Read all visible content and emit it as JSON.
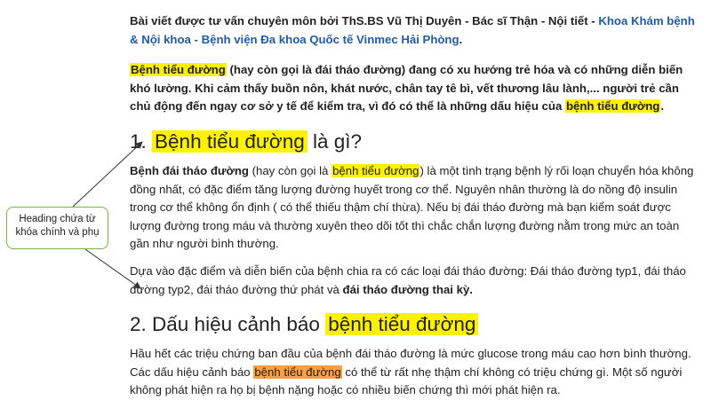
{
  "intro": {
    "prefix": "Bài viết được tư vấn chuyên môn bởi ThS.BS Vũ Thị Duyên - Bác sĩ Thận - Nội tiết - ",
    "link": "Khoa Khám bệnh & Nội khoa - Bệnh viện Đa khoa Quốc tế Vinmec Hải Phòng",
    "suffix": "."
  },
  "lead": {
    "kw1": "Bệnh tiểu đường",
    "text1": " (hay còn gọi là đái tháo đường) đang có xu hướng trẻ hóa và có những diễn biến khó lường. Khi cảm thấy buồn nôn, khát nước, chân tay tê bì, vết thương lâu lành,... người trẻ cần chủ động đến ngay cơ sở y tế để kiểm tra, vì đó có thể là những dấu hiệu của ",
    "kw2": "bệnh tiểu đường",
    "text2": "."
  },
  "section1": {
    "number": "1. ",
    "keyword": "Bệnh tiểu đường",
    "rest": " là gì?",
    "p1": {
      "bold": "Bệnh đái tháo đường",
      "t1": " (hay còn gọi là ",
      "kw": "bệnh tiểu đường",
      "t2": ") là một tình trạng bệnh lý rối loạn chuyển hóa không đồng nhất, có đặc điểm tăng lượng đường huyết trong cơ thể. Nguyên nhân thường là do nồng độ insulin trong cơ thể không ổn định ( có thể thiếu thậm chí thừa). Nếu bị đái tháo đường mà bạn kiểm soát được lượng đường trong máu và thường xuyên theo dõi tốt thì chắc chắn lượng đường nằm trong mức an toàn gần như người bình thường."
    },
    "p2": {
      "text": "Dựa vào đặc điểm và diễn biến của bệnh chia ra có các loại đái tháo đường: Đái tháo đường typ1, đái tháo đường typ2, đái tháo đường thứ phát và ",
      "bold": "đái tháo đường thai kỳ."
    }
  },
  "section2": {
    "number": "2. ",
    "rest": "Dấu hiệu cảnh báo ",
    "keyword": "bệnh tiểu đường",
    "p1": {
      "t1": "Hầu hết các triệu chứng ban đầu của bệnh đái tháo đường là mức glucose trong máu cao hơn bình thường. Các dấu hiệu cảnh báo ",
      "kw": "bệnh tiểu đường",
      "t2": " có thể từ rất nhẹ thậm chí không có triệu chứng gì. Một số người không phát hiện ra họ bị bệnh nặng hoặc có nhiều biến chứng thì mới phát hiện ra."
    }
  },
  "callout": {
    "text": "Heading chứa từ khóa chính và phụ"
  },
  "colors": {
    "highlight": "#fff200",
    "highlight_orange": "#ff9f43",
    "link": "#1f5ca8",
    "callout_border": "#7cb342"
  }
}
